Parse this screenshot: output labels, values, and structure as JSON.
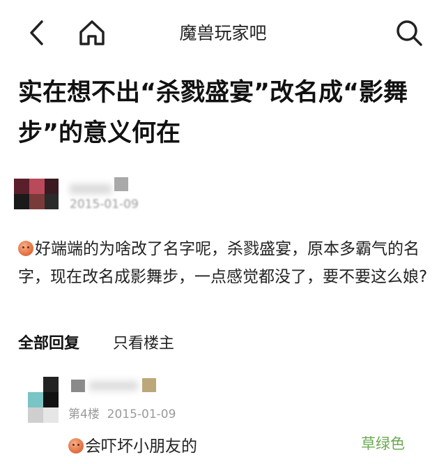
{
  "nav": {
    "title": "魔兽玩家吧",
    "back_icon": "chevron-left-icon",
    "home_icon": "home-icon",
    "search_icon": "search-icon"
  },
  "post": {
    "title": "实在想不出“杀戮盛宴”改名成“影舞步”的意义何在",
    "author_date": "2015-01-09",
    "body": "好端端的为啥改了名字呢，杀戮盛宴，原本多霸气的名字，现在改名成影舞步，一点感觉都没了，要不要这么娘?"
  },
  "actions": {
    "reply_all": "全部回复",
    "only_owner": "只看楼主"
  },
  "reply": {
    "floor": "第4楼",
    "date": "2015-01-09",
    "text": "会吓坏小朋友的",
    "tag": "草绿色"
  },
  "colors": {
    "tag_green": "#6aa84f",
    "meta_gray": "#9a9a9a"
  }
}
